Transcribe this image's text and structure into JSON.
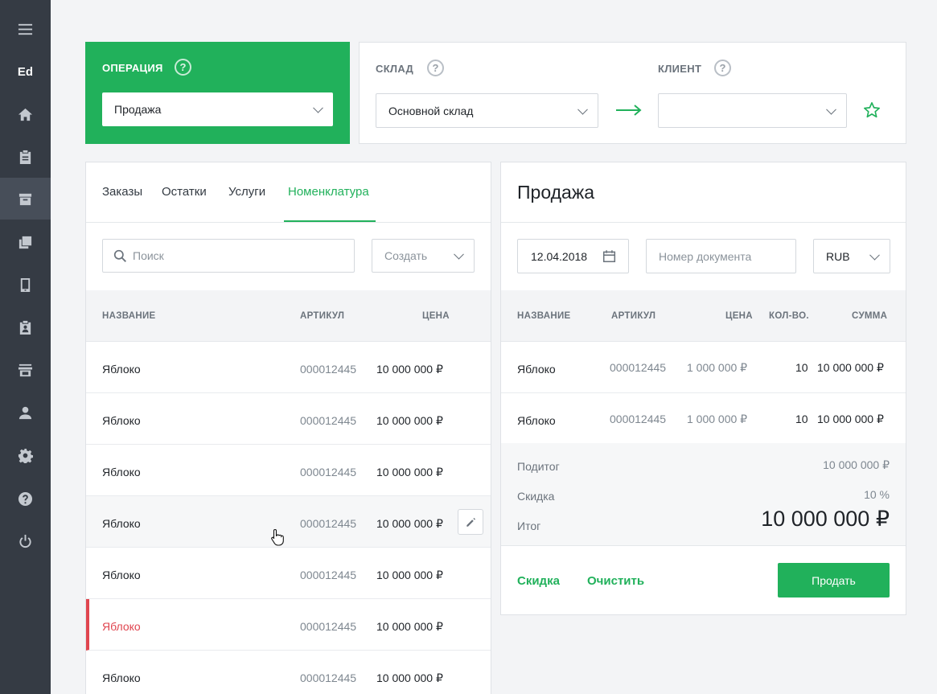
{
  "sidebar": {
    "brand": "Ed",
    "items": [
      {
        "icon": "menu-icon"
      },
      {
        "icon": "home-icon"
      },
      {
        "icon": "clipboard-icon"
      },
      {
        "icon": "archive-icon"
      },
      {
        "icon": "layers-icon"
      },
      {
        "icon": "tablet-icon"
      },
      {
        "icon": "badge-icon"
      },
      {
        "icon": "store-icon"
      },
      {
        "icon": "user-icon"
      },
      {
        "icon": "gear-icon"
      },
      {
        "icon": "help-icon"
      },
      {
        "icon": "power-icon"
      }
    ]
  },
  "operation": {
    "label": "ОПЕРАЦИЯ",
    "value": "Продажа"
  },
  "warehouse": {
    "label": "СКЛАД",
    "value": "Основной склад"
  },
  "client": {
    "label": "КЛИЕНТ",
    "value": ""
  },
  "left": {
    "tabs": [
      "Заказы",
      "Остатки",
      "Услуги",
      "Номенклатура"
    ],
    "active_tab": "Номенклатура",
    "search_placeholder": "Поиск",
    "create_label": "Создать",
    "columns": [
      "НАЗВАНИЕ",
      "АРТИКУЛ",
      "ЦЕНА"
    ],
    "rows": [
      {
        "name": "Яблоко",
        "article": "000012445",
        "price": "10 000  000 ₽"
      },
      {
        "name": "Яблоко",
        "article": "000012445",
        "price": "10 000  000 ₽"
      },
      {
        "name": "Яблоко",
        "article": "000012445",
        "price": "10 000  000 ₽"
      },
      {
        "name": "Яблоко",
        "article": "000012445",
        "price": "10 000  000 ₽"
      },
      {
        "name": "Яблоко",
        "article": "000012445",
        "price": "10 000  000 ₽"
      },
      {
        "name": "Яблоко",
        "article": "000012445",
        "price": "10 000  000 ₽"
      },
      {
        "name": "Яблоко",
        "article": "000012445",
        "price": "10 000  000 ₽"
      }
    ]
  },
  "right": {
    "title": "Продажа",
    "date": "12.04.2018",
    "doc_placeholder": "Номер документа",
    "currency": "RUB",
    "columns": [
      "НАЗВАНИЕ",
      "АРТИКУЛ",
      "ЦЕНА",
      "КОЛ-ВО.",
      "СУММА"
    ],
    "rows": [
      {
        "name": "Яблоко",
        "article": "000012445",
        "price": "1 000  000 ₽",
        "qty": "10",
        "sum": "10 000  000 ₽"
      },
      {
        "name": "Яблоко",
        "article": "000012445",
        "price": "1 000  000 ₽",
        "qty": "10",
        "sum": "10 000  000 ₽"
      }
    ],
    "subtotal_label": "Подитог",
    "subtotal": "10 000  000 ₽",
    "discount_label": "Скидка",
    "discount": "10 %",
    "total_label": "Итог",
    "total": "10 000 000 ₽",
    "discount_link": "Скидка",
    "clear_link": "Очистить",
    "sell_button": "Продать"
  },
  "colors": {
    "accent": "#21b15b",
    "sidebar": "#353b44",
    "alert": "#e0454f"
  }
}
